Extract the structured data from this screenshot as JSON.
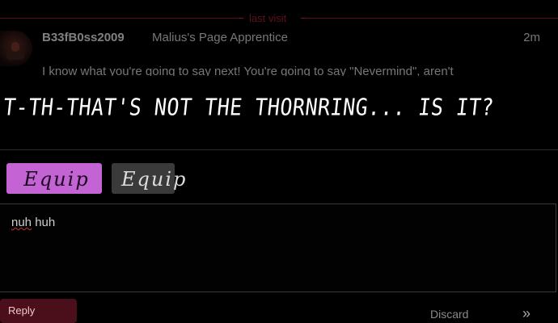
{
  "divider": {
    "label": "last visit"
  },
  "post": {
    "username": "B33fB0ss2009",
    "user_title": "Malius's Page Apprentice",
    "time": "2m",
    "body": "I know what you're going to say next! You're going to say \"Nevermind\", aren't"
  },
  "caption": {
    "text": "T-TH-THAT'S NOT THE THORNRING... IS IT?"
  },
  "buttons": {
    "equip_primary": "Equip",
    "equip_secondary": "Equip"
  },
  "composer": {
    "value_word1": "nuh",
    "value_word2": " huh"
  },
  "footer": {
    "back_label": "Reply",
    "discard_label": "Discard",
    "expand_glyph": "»"
  },
  "colors": {
    "accent_purple": "#c463d3",
    "divider_red": "#5a0d16",
    "button_gray": "#3a3a3a"
  }
}
